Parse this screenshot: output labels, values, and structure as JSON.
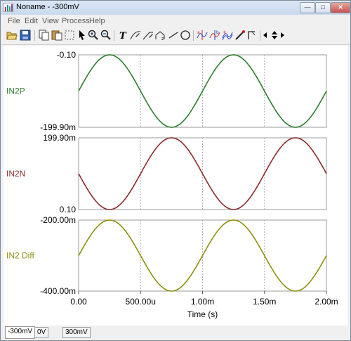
{
  "window": {
    "title": "Noname - -300mV"
  },
  "menu": [
    "File",
    "Edit",
    "View",
    "Process",
    "Help"
  ],
  "toolbar": {
    "icons": [
      "open-icon",
      "save-icon",
      "copy-icon",
      "paste-icon",
      "zoom-area-icon",
      "pointer-icon",
      "zoom-in-icon",
      "zoom-out-icon",
      "text-icon",
      "curve-edit-icon",
      "ramp-icon",
      "label-icon",
      "line-icon",
      "circle-icon",
      "cursor-a-icon",
      "cursor-b-icon",
      "peak-icon",
      "probe-icon",
      "step-icon",
      "nav-left-icon",
      "nav-updown-icon",
      "nav-right-icon"
    ]
  },
  "plot": {
    "x_axis_label": "Time (s)",
    "x_ticks": [
      "0.00",
      "500.00u",
      "1.00m",
      "1.50m",
      "2.00m"
    ],
    "panels": [
      {
        "label": "IN2P",
        "color": "#2e7d2e",
        "top_tick": "-0.10",
        "bottom_tick": "-199.90m"
      },
      {
        "label": "IN2N",
        "color": "#8b2a2a",
        "top_tick": "199.90m",
        "bottom_tick": "0.10"
      },
      {
        "label": "IN2 Diff",
        "color": "#8f8f10",
        "top_tick": "-200.00m",
        "bottom_tick": "-400.00m"
      }
    ]
  },
  "chart_data": [
    {
      "type": "line",
      "title": "",
      "xlabel": "Time (s)",
      "ylabel": "IN2P",
      "xlim": [
        0,
        0.002
      ],
      "ylim": [
        -0.1999,
        -0.0001
      ],
      "series": [
        {
          "name": "IN2P",
          "x": [
            0,
            0.00025,
            0.0005,
            0.00075,
            0.001,
            0.00125,
            0.0015,
            0.00175,
            0.002
          ],
          "y": [
            -0.1,
            -0.0001,
            -0.1,
            -0.1999,
            -0.1,
            -0.0001,
            -0.1,
            -0.1999,
            -0.1
          ]
        }
      ]
    },
    {
      "type": "line",
      "title": "",
      "xlabel": "Time (s)",
      "ylabel": "IN2N",
      "xlim": [
        0,
        0.002
      ],
      "ylim": [
        0.0001,
        0.1999
      ],
      "series": [
        {
          "name": "IN2N",
          "x": [
            0,
            0.00025,
            0.0005,
            0.00075,
            0.001,
            0.00125,
            0.0015,
            0.00175,
            0.002
          ],
          "y": [
            0.1,
            0.0001,
            0.1,
            0.1999,
            0.1,
            0.0001,
            0.1,
            0.1999,
            0.1
          ]
        }
      ]
    },
    {
      "type": "line",
      "title": "",
      "xlabel": "Time (s)",
      "ylabel": "IN2 Diff",
      "xlim": [
        0,
        0.002
      ],
      "ylim": [
        -0.4,
        -0.2
      ],
      "series": [
        {
          "name": "IN2 Diff",
          "x": [
            0,
            0.00025,
            0.0005,
            0.00075,
            0.001,
            0.00125,
            0.0015,
            0.00175,
            0.002
          ],
          "y": [
            -0.3,
            -0.2,
            -0.3,
            -0.4,
            -0.3,
            -0.2,
            -0.3,
            -0.4,
            -0.3
          ]
        }
      ]
    }
  ],
  "status_tabs": [
    "-300mV",
    "0V",
    "300mV"
  ]
}
